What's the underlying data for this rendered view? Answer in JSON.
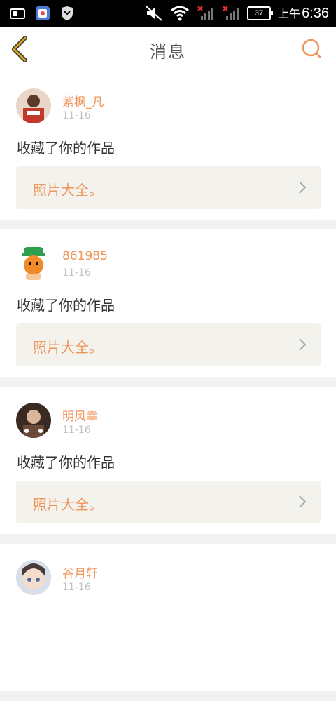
{
  "statusbar": {
    "battery": "37",
    "ampm": "上午",
    "time": "6:36"
  },
  "header": {
    "title": "消息"
  },
  "colors": {
    "accent": "#f0945a",
    "back_icon": "#d9a520",
    "text_primary": "#333333",
    "text_secondary": "#c0c0c0",
    "card_bg": "#ffffff",
    "work_bg": "#f3f2ec"
  },
  "messages": [
    {
      "user": "紫枫_凡",
      "date": "11-16",
      "action": "收藏了你的作品",
      "work": "照片大全。"
    },
    {
      "user": "861985",
      "date": "11-16",
      "action": "收藏了你的作品",
      "work": "照片大全。"
    },
    {
      "user": "明风幸",
      "date": "11-16",
      "action": "收藏了你的作品",
      "work": "照片大全。"
    },
    {
      "user": "谷月轩",
      "date": "11-16",
      "action": "",
      "work": ""
    }
  ]
}
